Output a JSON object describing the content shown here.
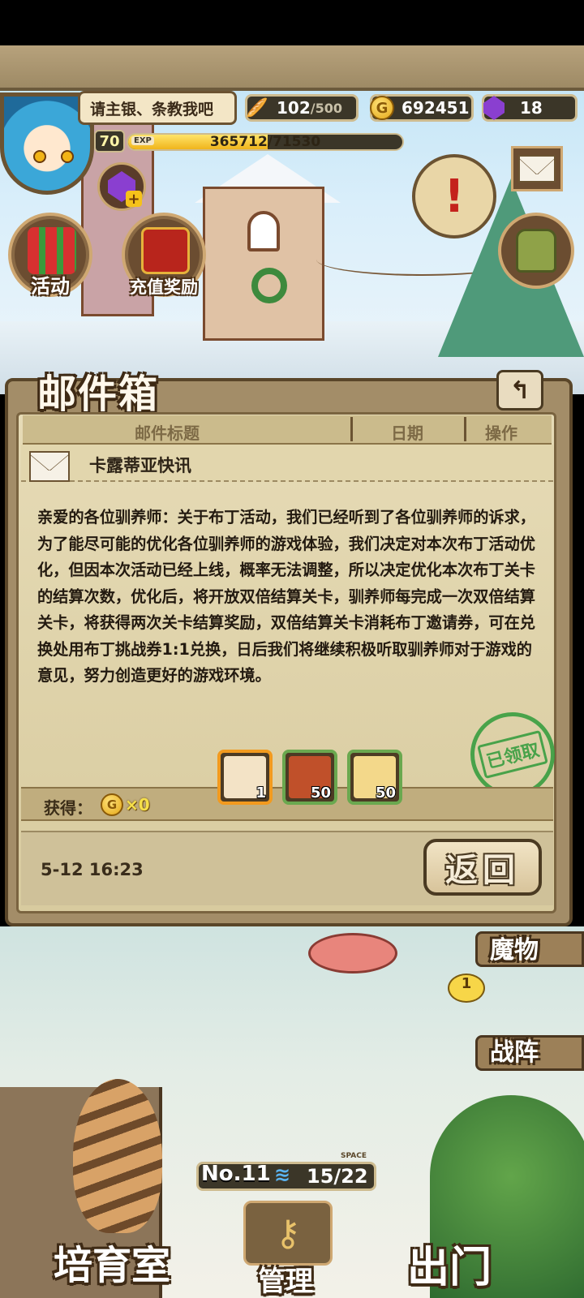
{
  "status_bar": {},
  "player": {
    "greeting": "请主银、条教我吧",
    "level": "70",
    "exp_label": "EXP",
    "exp_text": "365712/71530",
    "exp_progress": 0.51
  },
  "resources": {
    "bread_value": "102",
    "bread_max": "/500",
    "gold_symbol": "G",
    "gold_value": "692451",
    "gem_value": "18"
  },
  "menu": {
    "event_label": "活动",
    "recharge_label": "充值奖励"
  },
  "mailbox": {
    "title": "邮件箱",
    "back_icon": "↰",
    "columns": [
      "邮件标题",
      "日期",
      "操作"
    ],
    "subject": "卡露蒂亚快讯",
    "body": "亲爱的各位驯养师：关于布丁活动，我们已经听到了各位驯养师的诉求，为了能尽可能的优化各位驯养师的游戏体验，我们决定对本次布丁活动优化，但因本次活动已经上线，概率无法调整，所以决定优化本次布丁关卡的结算次数，优化后，将开放双倍结算关卡，驯养师每完成一次双倍结算关卡，将获得两次关卡结算奖励，双倍结算关卡消耗布丁邀请券，可在兑换处用布丁挑战券1:1兑换，日后我们将继续积极听取驯养师对于游戏的意见，努力创造更好的游戏环境。",
    "stamp_text": "已领取",
    "reward_label": "获得：",
    "reward_coin_symbol": "G",
    "reward_coin_qty": "×0",
    "items": [
      {
        "qty": "1",
        "color": "#f3e3c6",
        "frame": "orange"
      },
      {
        "qty": "50",
        "color": "#c0502a",
        "frame": "green"
      },
      {
        "qty": "50",
        "color": "#f3d88a",
        "frame": "green"
      }
    ],
    "date": "5-12 16:23",
    "return_label": "返回"
  },
  "right_menu": {
    "monster_label": "魔物",
    "level_badge": "1",
    "formation_label": "战阵"
  },
  "capacity": {
    "number_label": "No.11",
    "space_label": "SPACE",
    "wave_icon": "≋",
    "value": "15/22"
  },
  "bottom_nav": {
    "nursery_label": "培育室",
    "manage_label": "管理",
    "exit_label": "出门"
  },
  "colors": {
    "frame": "#6b5332",
    "paper": "#e6dbb6",
    "accent_gold": "#f0b41b",
    "stamp_green": "#2f9b3a"
  }
}
